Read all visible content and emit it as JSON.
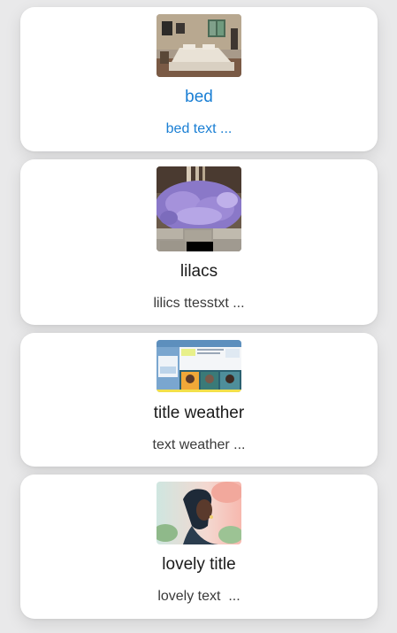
{
  "colors": {
    "accent": "#1a7fd4",
    "text": "#1a1a1a",
    "background": "#e9e9ea",
    "card": "#ffffff"
  },
  "items": [
    {
      "title": "bed",
      "description": "bed text ...",
      "image": "bedroom-photo",
      "selected": true
    },
    {
      "title": "lilacs",
      "description": "lilics ttesstxt ...",
      "image": "lilac-flowers-photo",
      "selected": false
    },
    {
      "title": "title weather",
      "description": "text weather ...",
      "image": "weather-webpage-screenshot",
      "selected": false
    },
    {
      "title": "lovely title",
      "description": "lovely text  ...",
      "image": "woman-portrait-illustration",
      "selected": false
    }
  ]
}
